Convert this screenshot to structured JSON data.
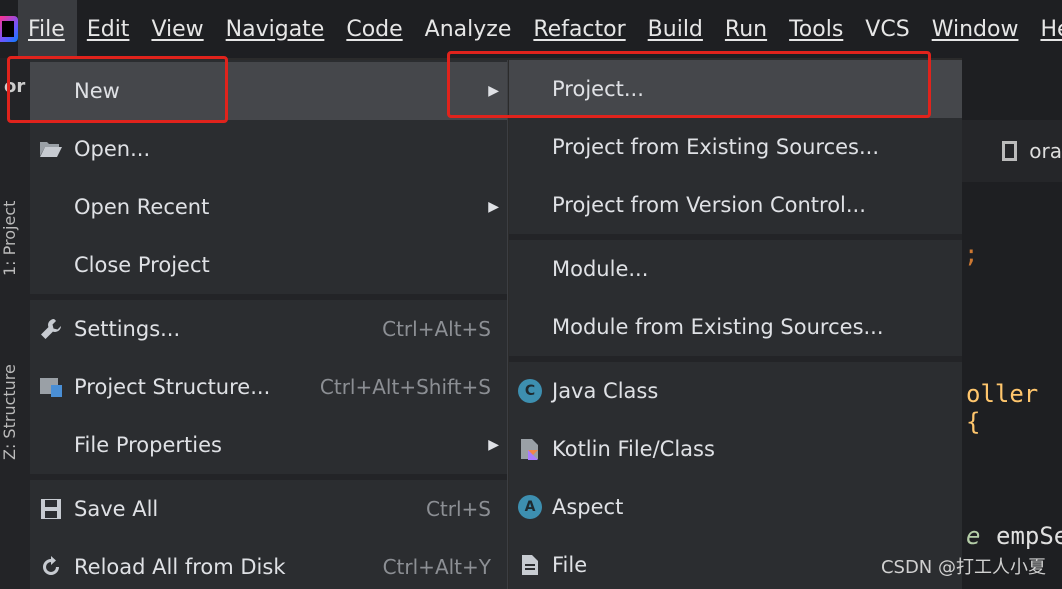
{
  "menubar": {
    "items": [
      {
        "label": "File"
      },
      {
        "label": "Edit"
      },
      {
        "label": "View"
      },
      {
        "label": "Navigate"
      },
      {
        "label": "Code"
      },
      {
        "label": "Analyze"
      },
      {
        "label": "Refactor"
      },
      {
        "label": "Build"
      },
      {
        "label": "Run"
      },
      {
        "label": "Tools"
      },
      {
        "label": "VCS"
      },
      {
        "label": "Window"
      },
      {
        "label": "Help"
      }
    ]
  },
  "sidebar": {
    "project_tab": "1: Project",
    "structure_tab": "Z: Structure",
    "cut_label": "or"
  },
  "file_menu": {
    "items": [
      {
        "label": "New",
        "shortcut": ""
      },
      {
        "label": "Open...",
        "shortcut": ""
      },
      {
        "label": "Open Recent",
        "shortcut": ""
      },
      {
        "label": "Close Project",
        "shortcut": ""
      },
      {
        "label": "Settings...",
        "shortcut": "Ctrl+Alt+S"
      },
      {
        "label": "Project Structure...",
        "shortcut": "Ctrl+Alt+Shift+S"
      },
      {
        "label": "File Properties",
        "shortcut": ""
      },
      {
        "label": "Save All",
        "shortcut": "Ctrl+S"
      },
      {
        "label": "Reload All from Disk",
        "shortcut": "Ctrl+Alt+Y"
      }
    ]
  },
  "new_submenu": {
    "items": [
      {
        "label": "Project..."
      },
      {
        "label": "Project from Existing Sources..."
      },
      {
        "label": "Project from Version Control..."
      },
      {
        "label": "Module..."
      },
      {
        "label": "Module from Existing Sources..."
      },
      {
        "label": "Java Class",
        "badge": "C"
      },
      {
        "label": "Kotlin File/Class"
      },
      {
        "label": "Aspect",
        "badge": "A"
      },
      {
        "label": "File"
      }
    ]
  },
  "editor": {
    "tab_label": "ora",
    "code_semicolon": ";",
    "code_oller": "oller {",
    "code_e": "e",
    "code_empse": "empSe"
  },
  "watermark": "CSDN @打工人小夏",
  "colors": {
    "annotation": "#e0231c",
    "highlight": "#45474b",
    "menu_bg": "#2b2d30"
  }
}
